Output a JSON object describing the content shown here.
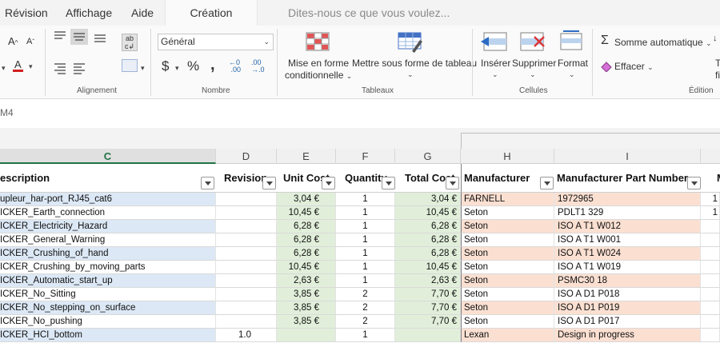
{
  "tabs": [
    "Révision",
    "Affichage",
    "Aide",
    "Création"
  ],
  "search_placeholder": "Dites-nous ce que vous voulez...",
  "ribbon": {
    "alignment_label": "Alignement",
    "number_format": "Général",
    "number_label": "Nombre",
    "cond_format_line1": "Mise en forme",
    "cond_format_line2": "conditionnelle",
    "table_format": "Mettre sous forme de tableau",
    "tables_label": "Tableaux",
    "insert": "Insérer",
    "delete": "Supprimer",
    "format": "Format",
    "cells_label": "Cellules",
    "autosum": "Somme automatique",
    "clear": "Effacer",
    "editing_label": "Édition",
    "trunc1": "T",
    "trunc2": "fi"
  },
  "name_box": "M4",
  "columns": [
    "C",
    "D",
    "E",
    "F",
    "G",
    "H",
    "I"
  ],
  "headers": [
    "escription",
    "Revision",
    "Unit Cost",
    "Quantity",
    "Total Cost",
    "Manufacturer",
    "Manufacturer Part Number",
    "M"
  ],
  "rows": [
    {
      "desc": "upleur_har-port_RJ45_cat6",
      "rev": "",
      "unit": "3,04 €",
      "qty": "1",
      "total": "3,04 €",
      "mfr": "FARNELL",
      "part": "1972965",
      "m": "1"
    },
    {
      "desc": "ICKER_Earth_connection",
      "rev": "",
      "unit": "10,45 €",
      "qty": "1",
      "total": "10,45 €",
      "mfr": "Seton",
      "part": "PDLT1 329",
      "m": "1"
    },
    {
      "desc": "ICKER_Electricity_Hazard",
      "rev": "",
      "unit": "6,28 €",
      "qty": "1",
      "total": "6,28 €",
      "mfr": "Seton",
      "part": "ISO A T1 W012",
      "m": ""
    },
    {
      "desc": "ICKER_General_Warning",
      "rev": "",
      "unit": "6,28 €",
      "qty": "1",
      "total": "6,28 €",
      "mfr": "Seton",
      "part": "ISO A T1 W001",
      "m": ""
    },
    {
      "desc": "ICKER_Crushing_of_hand",
      "rev": "",
      "unit": "6,28 €",
      "qty": "1",
      "total": "6,28 €",
      "mfr": "Seton",
      "part": "ISO A T1 W024",
      "m": ""
    },
    {
      "desc": "ICKER_Crushing_by_moving_parts",
      "rev": "",
      "unit": "10,45 €",
      "qty": "1",
      "total": "10,45 €",
      "mfr": "Seton",
      "part": "ISO A T1 W019",
      "m": ""
    },
    {
      "desc": "ICKER_Automatic_start_up",
      "rev": "",
      "unit": "2,63 €",
      "qty": "1",
      "total": "2,63 €",
      "mfr": "Seton",
      "part": "PSMC30 18",
      "m": ""
    },
    {
      "desc": "ICKER_No_Sitting",
      "rev": "",
      "unit": "3,85 €",
      "qty": "2",
      "total": "7,70 €",
      "mfr": "Seton",
      "part": "ISO A D1 P018",
      "m": ""
    },
    {
      "desc": "ICKER_No_stepping_on_surface",
      "rev": "",
      "unit": "3,85 €",
      "qty": "2",
      "total": "7,70 €",
      "mfr": "Seton",
      "part": "ISO A D1 P019",
      "m": ""
    },
    {
      "desc": "ICKER_No_pushing",
      "rev": "",
      "unit": "3,85 €",
      "qty": "2",
      "total": "7,70 €",
      "mfr": "Seton",
      "part": "ISO A D1 P017",
      "m": ""
    },
    {
      "desc": "ICKER_HCI_bottom",
      "rev": "1.0",
      "unit": "",
      "qty": "1",
      "total": "",
      "mfr": "Lexan",
      "part": "Design in progress",
      "m": ""
    }
  ],
  "colors": {
    "blue_band": "#dce8f5",
    "green_band": "#e1efda",
    "peach_band": "#fbe0d2",
    "header_green": "#217346"
  }
}
